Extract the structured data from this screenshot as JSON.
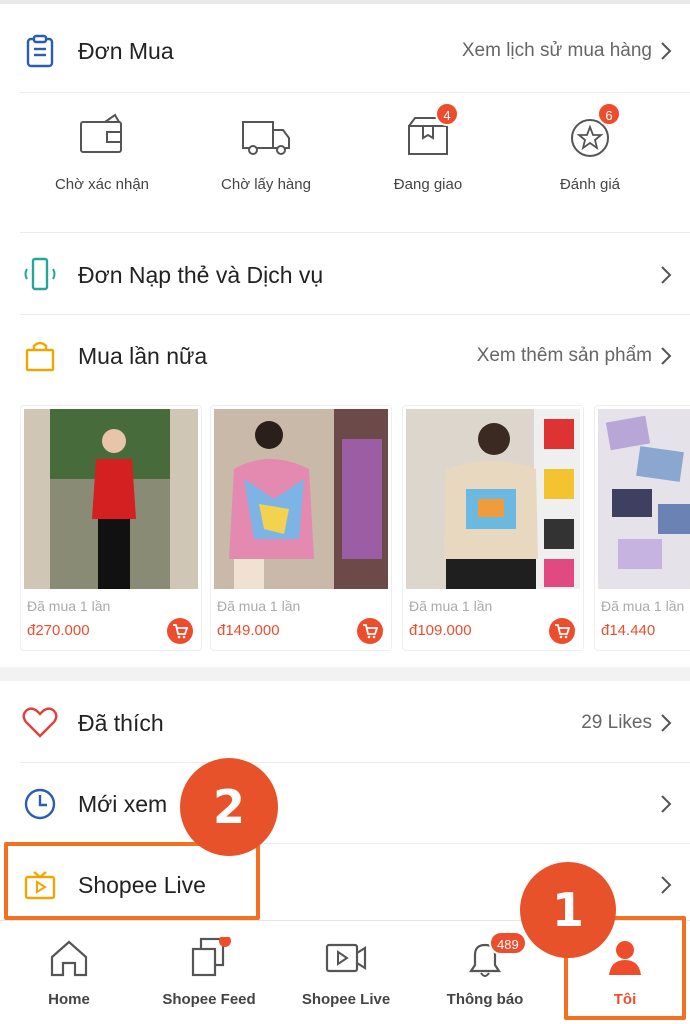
{
  "orders": {
    "title": "Đơn Mua",
    "history_link": "Xem lịch sử mua hàng",
    "statuses": [
      {
        "label": "Chờ xác nhận",
        "badge": ""
      },
      {
        "label": "Chờ lấy hàng",
        "badge": ""
      },
      {
        "label": "Đang giao",
        "badge": "4"
      },
      {
        "label": "Đánh giá",
        "badge": "6"
      }
    ]
  },
  "topup": {
    "title": "Đơn Nạp thẻ và Dịch vụ"
  },
  "buy_again": {
    "title": "Mua lần nữa",
    "more_link": "Xem thêm sản phẩm",
    "products": [
      {
        "bought": "Đã mua 1 lần",
        "price": "đ270.000"
      },
      {
        "bought": "Đã mua 1 lần",
        "price": "đ149.000"
      },
      {
        "bought": "Đã mua 1 lần",
        "price": "đ109.000"
      },
      {
        "bought": "Đã mua 1 lần",
        "price": "đ14.440"
      }
    ]
  },
  "liked": {
    "title": "Đã thích",
    "count": "29 Likes"
  },
  "recent": {
    "title": "Mới xem"
  },
  "live": {
    "title": "Shopee Live"
  },
  "bottom_nav": {
    "items": [
      {
        "label": "Home",
        "badge": ""
      },
      {
        "label": "Shopee Feed",
        "badge": ""
      },
      {
        "label": "Shopee Live",
        "badge": ""
      },
      {
        "label": "Thông báo",
        "badge": "489"
      },
      {
        "label": "Tôi",
        "badge": ""
      }
    ]
  },
  "annotations": {
    "step1": "1",
    "step2": "2"
  },
  "colors": {
    "accent": "#ee4d2d",
    "highlight": "#f37021",
    "step_bg": "#e8522a"
  }
}
